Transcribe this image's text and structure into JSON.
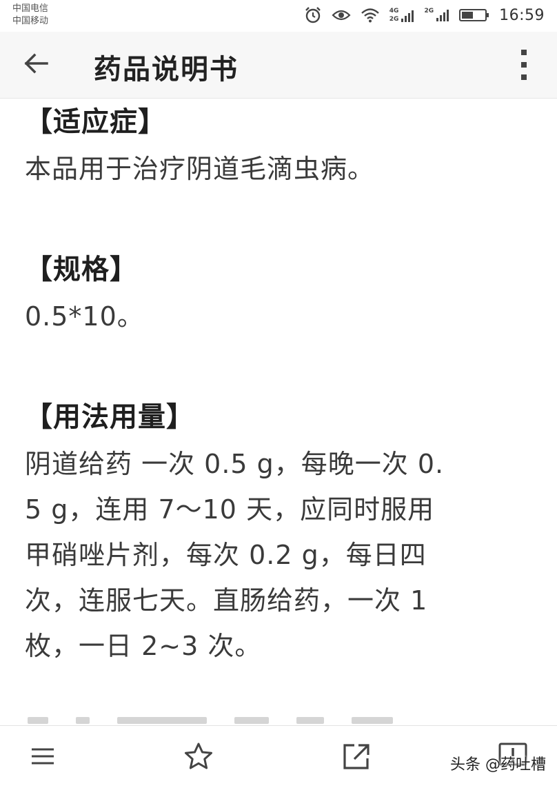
{
  "status_bar": {
    "carrier_1": "中国电信",
    "carrier_2": "中国移动",
    "net_a_top": "4G",
    "net_a_bottom": "2G",
    "net_b": "2G",
    "time": "16:59"
  },
  "app_bar": {
    "title": "药品说明书",
    "back_icon": "arrow-left-icon",
    "more_icon": "more-vertical-icon"
  },
  "sections": [
    {
      "heading": "【适应症】",
      "body": "本品用于治疗阴道毛滴虫病。"
    },
    {
      "heading": "【规格】",
      "body": "0.5*10。"
    },
    {
      "heading": "【用法用量】",
      "lines": [
        "阴道给药 一次 0.5 g，每晚一次 0.",
        "5 g，连用 7～10 天，应同时服用",
        "甲硝唑片剂，每次 0.2 g，每日四",
        "次，连服七天。直肠给药，一次 1",
        "枚，一日 2~3 次。"
      ]
    }
  ],
  "bottom_bar": {
    "items": [
      "menu-icon",
      "star-icon",
      "share-icon",
      "feedback-icon"
    ]
  },
  "watermark": "头条 @药吐槽",
  "colors": {
    "app_bar_bg": "#f7f7f7",
    "text": "#3a3a3a",
    "heading": "#1f1f1f"
  }
}
